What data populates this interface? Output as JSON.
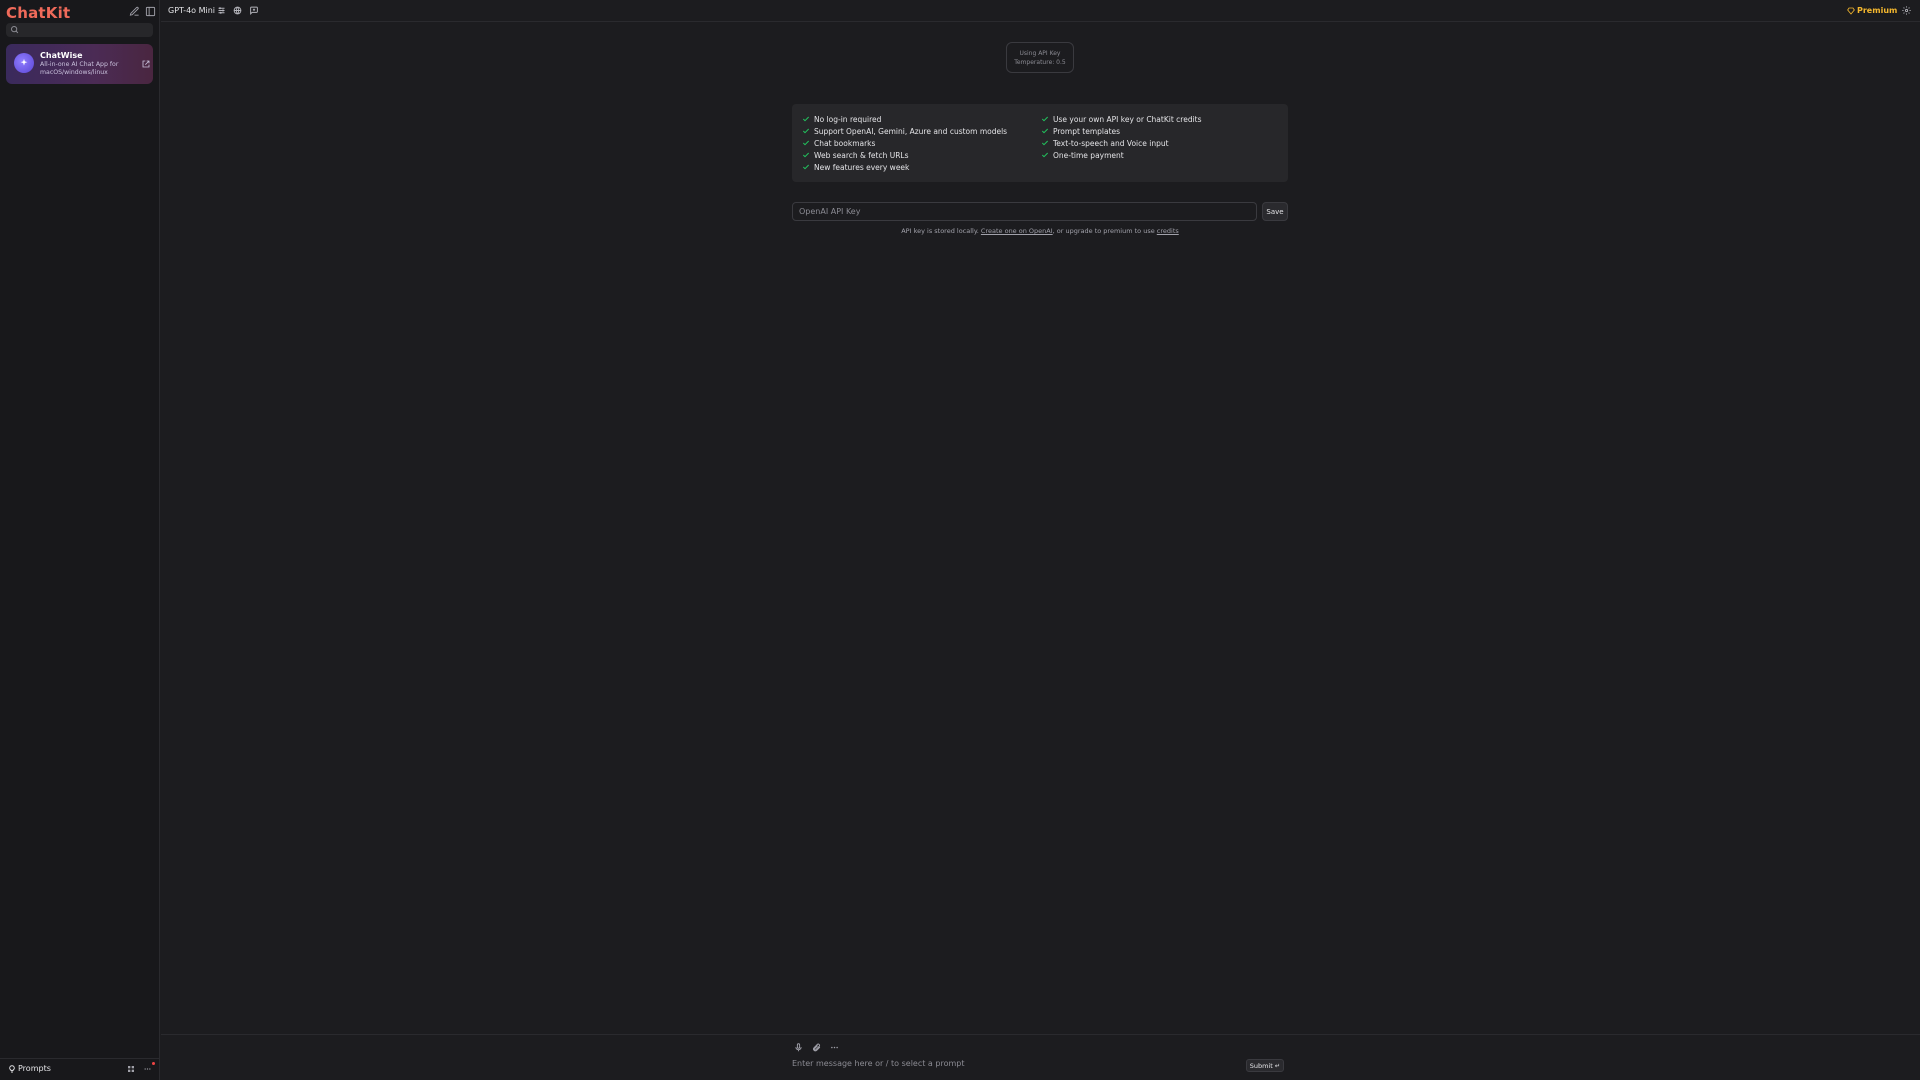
{
  "sidebar": {
    "brand": "ChatKit",
    "search_placeholder": "",
    "promo": {
      "title": "ChatWise",
      "description": "All-in-one AI Chat App for macOS/windows/linux"
    },
    "bottom": {
      "prompts_label": "Prompts"
    }
  },
  "topbar": {
    "model": "GPT-4o Mini",
    "premium_label": "Premium"
  },
  "main": {
    "key_badge": {
      "line1": "Using API Key",
      "line2": "Temperature: 0.5"
    },
    "features_left": [
      "No log-in required",
      "Support OpenAI, Gemini, Azure and custom models",
      "Chat bookmarks",
      "Web search & fetch URLs",
      "New features every week"
    ],
    "features_right": [
      "Use your own API key or ChatKit credits",
      "Prompt templates",
      "Text-to-speech and Voice input",
      "One-time payment"
    ],
    "api_key_placeholder": "OpenAI API Key",
    "save_label": "Save",
    "note": {
      "prefix": "API key is stored locally. ",
      "link_create": "Create one on OpenAI",
      "middle": ", or upgrade to premium to use ",
      "link_credits": "credits"
    }
  },
  "composer": {
    "placeholder": "Enter message here or / to select a prompt",
    "submit_label": "Submit ↵"
  },
  "colors": {
    "brand": "#f06a5a",
    "premium": "#f5b82e",
    "check": "#22c55e",
    "notification_dot": "#ef4444"
  }
}
